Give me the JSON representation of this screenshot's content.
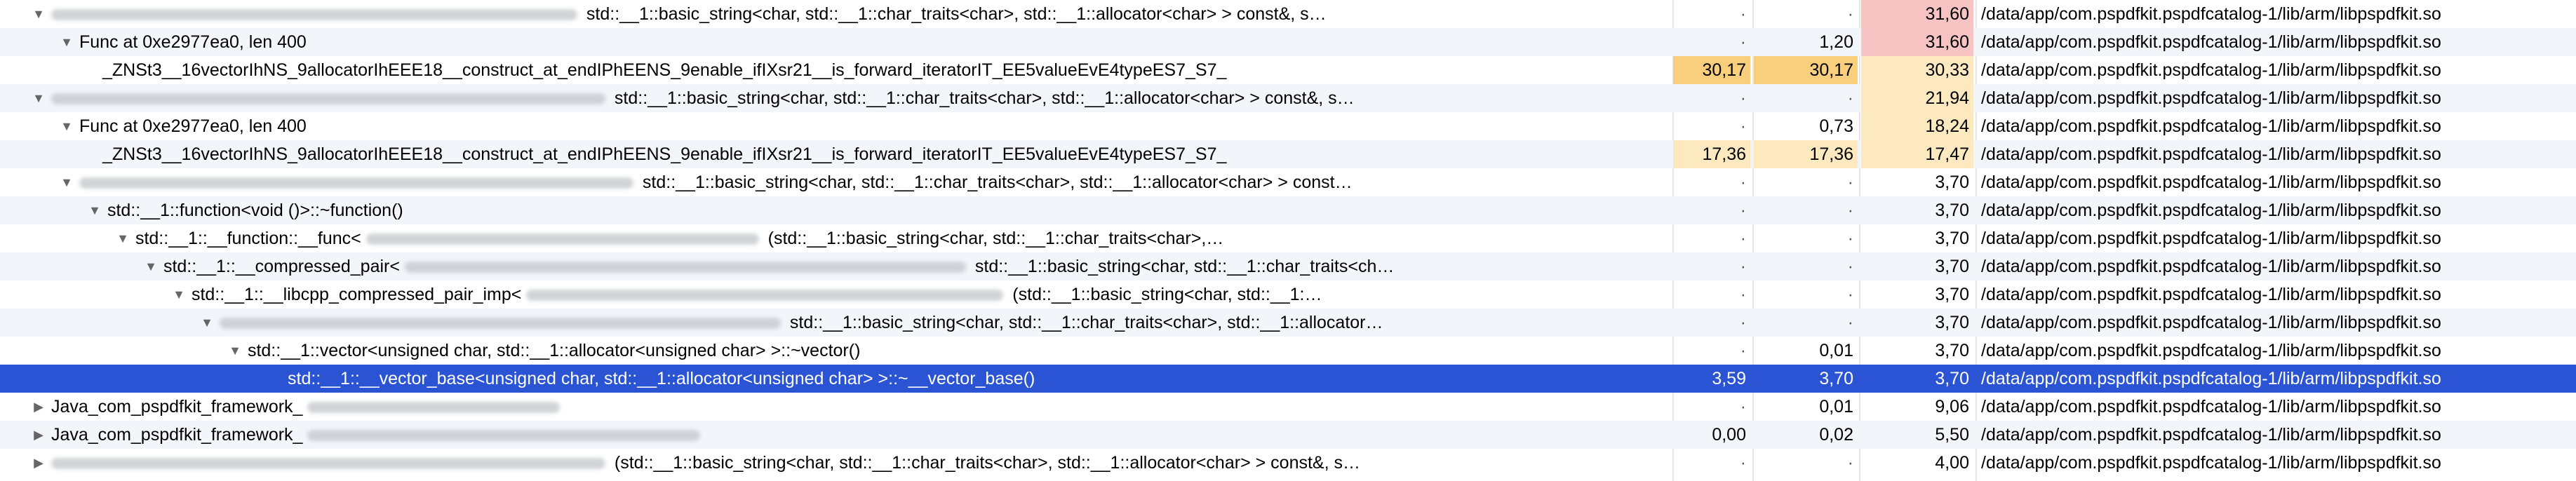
{
  "rows": [
    {
      "name": "std::__1::basic_string<char, std::__1::char_traits<char>, std::__1::allocator<char> > const&, s…",
      "c1": "·",
      "c2": "·",
      "c3": "31,60",
      "path": "/data/app/com.pspdfkit.pspdfcatalog-1/lib/arm/libpspdfkit.so"
    },
    {
      "name": "Func at 0xe2977ea0, len 400",
      "c1": "·",
      "c2": "1,20",
      "c3": "31,60",
      "path": "/data/app/com.pspdfkit.pspdfcatalog-1/lib/arm/libpspdfkit.so"
    },
    {
      "name": "_ZNSt3__16vectorIhNS_9allocatorIhEEE18__construct_at_endIPhEENS_9enable_ifIXsr21__is_forward_iteratorIT_EE5valueEvE4typeES7_S7_",
      "c1": "30,17",
      "c2": "30,17",
      "c3": "30,33",
      "path": "/data/app/com.pspdfkit.pspdfcatalog-1/lib/arm/libpspdfkit.so"
    },
    {
      "name": "std::__1::basic_string<char, std::__1::char_traits<char>, std::__1::allocator<char> > const&, s…",
      "c1": "·",
      "c2": "·",
      "c3": "21,94",
      "path": "/data/app/com.pspdfkit.pspdfcatalog-1/lib/arm/libpspdfkit.so"
    },
    {
      "name": "Func at 0xe2977ea0, len 400",
      "c1": "·",
      "c2": "0,73",
      "c3": "18,24",
      "path": "/data/app/com.pspdfkit.pspdfcatalog-1/lib/arm/libpspdfkit.so"
    },
    {
      "name": "_ZNSt3__16vectorIhNS_9allocatorIhEEE18__construct_at_endIPhEENS_9enable_ifIXsr21__is_forward_iteratorIT_EE5valueEvE4typeES7_S7_",
      "c1": "17,36",
      "c2": "17,36",
      "c3": "17,47",
      "path": "/data/app/com.pspdfkit.pspdfcatalog-1/lib/arm/libpspdfkit.so"
    },
    {
      "name": "std::__1::basic_string<char, std::__1::char_traits<char>, std::__1::allocator<char> > const…",
      "c1": "·",
      "c2": "·",
      "c3": "3,70",
      "path": "/data/app/com.pspdfkit.pspdfcatalog-1/lib/arm/libpspdfkit.so"
    },
    {
      "name": "std::__1::function<void ()>::~function()",
      "c1": "·",
      "c2": "·",
      "c3": "3,70",
      "path": "/data/app/com.pspdfkit.pspdfcatalog-1/lib/arm/libpspdfkit.so"
    },
    {
      "name": "std::__1::__function::__func<",
      "name2": "(std::__1::basic_string<char, std::__1::char_traits<char>,…",
      "c1": "·",
      "c2": "·",
      "c3": "3,70",
      "path": "/data/app/com.pspdfkit.pspdfcatalog-1/lib/arm/libpspdfkit.so"
    },
    {
      "name": "std::__1::__compressed_pair<",
      "name2": "std::__1::basic_string<char, std::__1::char_traits<ch…",
      "c1": "·",
      "c2": "·",
      "c3": "3,70",
      "path": "/data/app/com.pspdfkit.pspdfcatalog-1/lib/arm/libpspdfkit.so"
    },
    {
      "name": "std::__1::__libcpp_compressed_pair_imp<",
      "name2": "(std::__1::basic_string<char, std::__1:…",
      "c1": "·",
      "c2": "·",
      "c3": "3,70",
      "path": "/data/app/com.pspdfkit.pspdfcatalog-1/lib/arm/libpspdfkit.so"
    },
    {
      "name": "std::__1::basic_string<char, std::__1::char_traits<char>, std::__1::allocator…",
      "c1": "·",
      "c2": "·",
      "c3": "3,70",
      "path": "/data/app/com.pspdfkit.pspdfcatalog-1/lib/arm/libpspdfkit.so"
    },
    {
      "name": "std::__1::vector<unsigned char, std::__1::allocator<unsigned char> >::~vector()",
      "c1": "·",
      "c2": "0,01",
      "c3": "3,70",
      "path": "/data/app/com.pspdfkit.pspdfcatalog-1/lib/arm/libpspdfkit.so"
    },
    {
      "name": "std::__1::__vector_base<unsigned char, std::__1::allocator<unsigned char> >::~__vector_base()",
      "c1": "3,59",
      "c2": "3,70",
      "c3": "3,70",
      "path": "/data/app/com.pspdfkit.pspdfcatalog-1/lib/arm/libpspdfkit.so"
    },
    {
      "name": "Java_com_pspdfkit_framework_",
      "c1": "·",
      "c2": "0,01",
      "c3": "9,06",
      "path": "/data/app/com.pspdfkit.pspdfcatalog-1/lib/arm/libpspdfkit.so"
    },
    {
      "name": "Java_com_pspdfkit_framework_",
      "c1": "0,00",
      "c2": "0,02",
      "c3": "5,50",
      "path": "/data/app/com.pspdfkit.pspdfcatalog-1/lib/arm/libpspdfkit.so"
    },
    {
      "name": "(std::__1::basic_string<char, std::__1::char_traits<char>, std::__1::allocator<char> > const&, s…",
      "c1": "·",
      "c2": "·",
      "c3": "4,00",
      "path": "/data/app/com.pspdfkit.pspdfcatalog-1/lib/arm/libpspdfkit.so"
    }
  ]
}
